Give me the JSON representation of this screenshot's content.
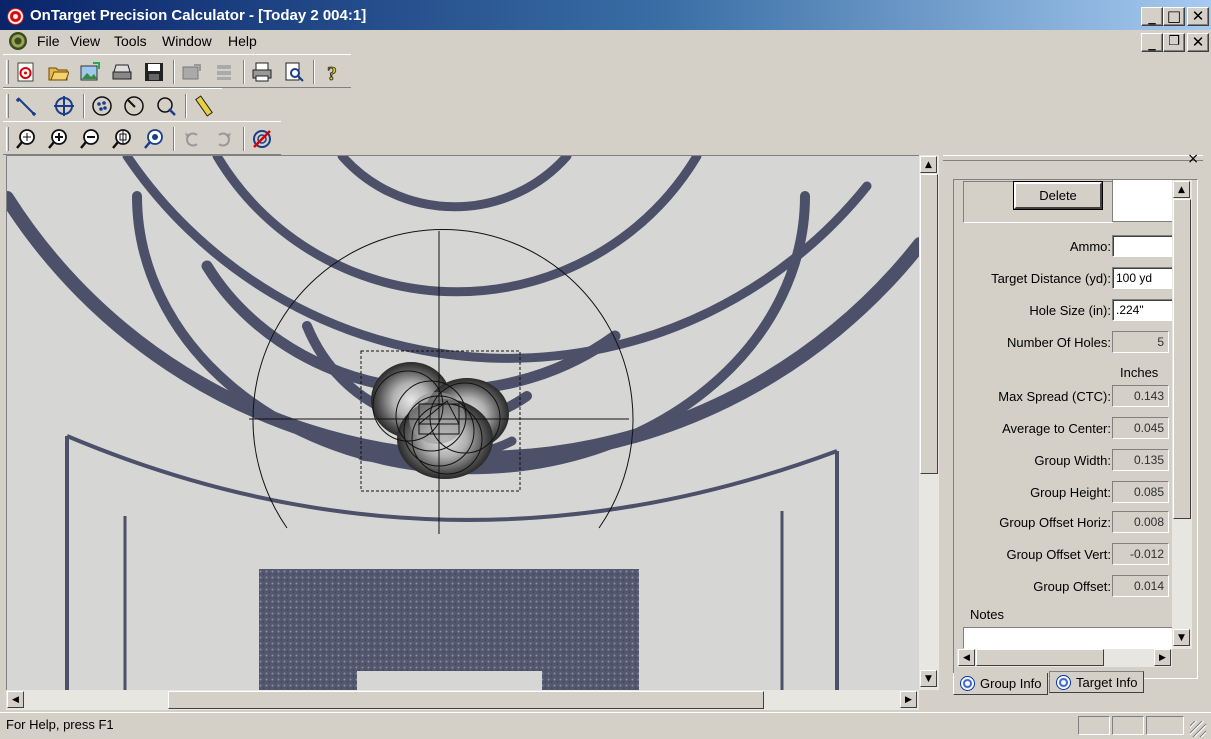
{
  "window": {
    "title": "OnTarget Precision Calculator - [Today 2 004:1]",
    "caption_buttons": {
      "minimize": "_",
      "maximize": "□",
      "close": "✕"
    },
    "child_buttons": {
      "minimize": "_",
      "restore": "❐",
      "close": "✕"
    }
  },
  "menu": {
    "items": [
      "File",
      "View",
      "Tools",
      "Window",
      "Help"
    ]
  },
  "toolbars": {
    "row1": [
      "new-target-icon",
      "open-folder-icon",
      "open-image-icon",
      "scan-icon",
      "save-icon",
      "edit-image-icon",
      "batch-icon",
      "print-icon",
      "print-preview-icon",
      "help-icon"
    ],
    "row2": [
      "line-tool-icon",
      "crosshair-icon",
      "group-tool-icon",
      "bullseye-tool-icon",
      "zoom-region-icon",
      "ruler-icon"
    ],
    "row3": [
      "zoom-in-icon",
      "zoom-plus-icon",
      "zoom-minus-icon",
      "zoom-fit-icon",
      "zoom-actual-icon",
      "rotate-left-icon",
      "rotate-right-icon",
      "no-target-icon"
    ]
  },
  "panel": {
    "close_glyph": "×",
    "delete_label": "Delete",
    "fields": {
      "ammo": {
        "label": "Ammo:",
        "value": ""
      },
      "target_distance": {
        "label": "Target Distance (yd):",
        "value": "100 yd"
      },
      "hole_size": {
        "label": "Hole Size (in):",
        "value": ".224\""
      },
      "number_of_holes": {
        "label": "Number Of Holes:",
        "value": "5"
      }
    },
    "units_header": "Inches",
    "results": [
      {
        "label": "Max Spread (CTC):",
        "value": "0.143"
      },
      {
        "label": "Average to Center:",
        "value": "0.045"
      },
      {
        "label": "Group Width:",
        "value": "0.135"
      },
      {
        "label": "Group Height:",
        "value": "0.085"
      },
      {
        "label": "Group Offset Horiz:",
        "value": "0.008"
      },
      {
        "label": "Group Offset Vert:",
        "value": "-0.012"
      },
      {
        "label": "Group Offset:",
        "value": "0.014"
      }
    ],
    "notes_label": "Notes",
    "tabs": [
      "Group Info",
      "Target Info"
    ]
  },
  "status": {
    "text": "For Help, press F1"
  },
  "colors": {
    "title_start": "#0a246a",
    "title_end": "#a6caf0",
    "face": "#d4d0c8",
    "target_ink": "#4a4f6a",
    "paper": "#d7d8d6"
  }
}
